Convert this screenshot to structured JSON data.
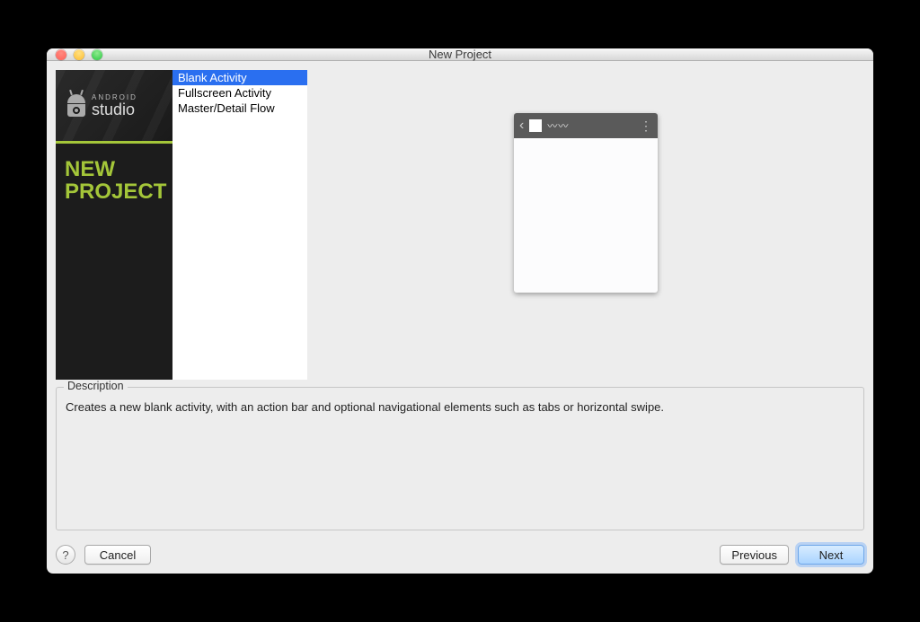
{
  "window": {
    "title": "New Project"
  },
  "brand": {
    "small": "ANDROID",
    "big": "studio",
    "headline1": "NEW",
    "headline2": "PROJECT"
  },
  "activities": [
    {
      "label": "Blank Activity",
      "selected": true
    },
    {
      "label": "Fullscreen Activity",
      "selected": false
    },
    {
      "label": "Master/Detail Flow",
      "selected": false
    }
  ],
  "description": {
    "legend": "Description",
    "text": "Creates a new blank activity, with an action bar and optional navigational elements such as tabs or horizontal swipe."
  },
  "footer": {
    "help": "?",
    "cancel": "Cancel",
    "previous": "Previous",
    "next": "Next"
  }
}
